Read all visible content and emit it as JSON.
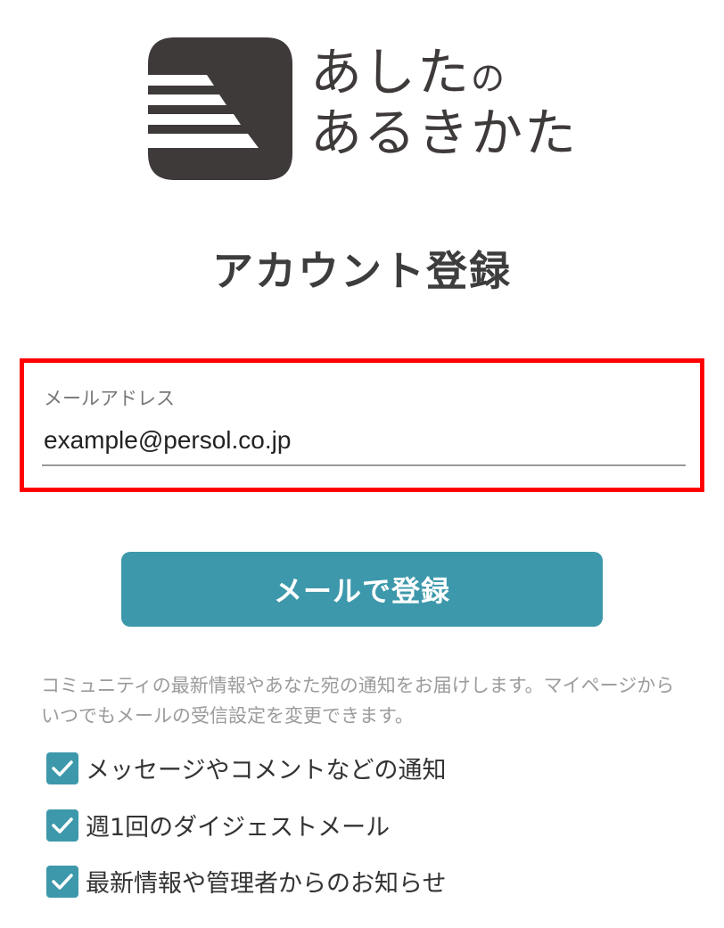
{
  "brand": {
    "logo_line1_main": "あした",
    "logo_line1_small": "の",
    "logo_line2": "あるきかた",
    "color_dark": "#3f3a3a"
  },
  "page_title": "アカウント登録",
  "email": {
    "label": "メールアドレス",
    "value": "example@persol.co.jp",
    "highlight_color": "#ff0000"
  },
  "register_button": {
    "label": "メールで登録",
    "color": "#3d98ab"
  },
  "notice_text": "コミュニティの最新情報やあなた宛の通知をお届けします。マイページからいつでもメールの受信設定を変更できます。",
  "options": [
    {
      "label": "メッセージやコメントなどの通知",
      "checked": true,
      "icon": "checkmark-icon"
    },
    {
      "label": "週1回のダイジェストメール",
      "checked": true,
      "icon": "checkmark-icon"
    },
    {
      "label": "最新情報や管理者からのお知らせ",
      "checked": true,
      "icon": "checkmark-icon"
    }
  ]
}
